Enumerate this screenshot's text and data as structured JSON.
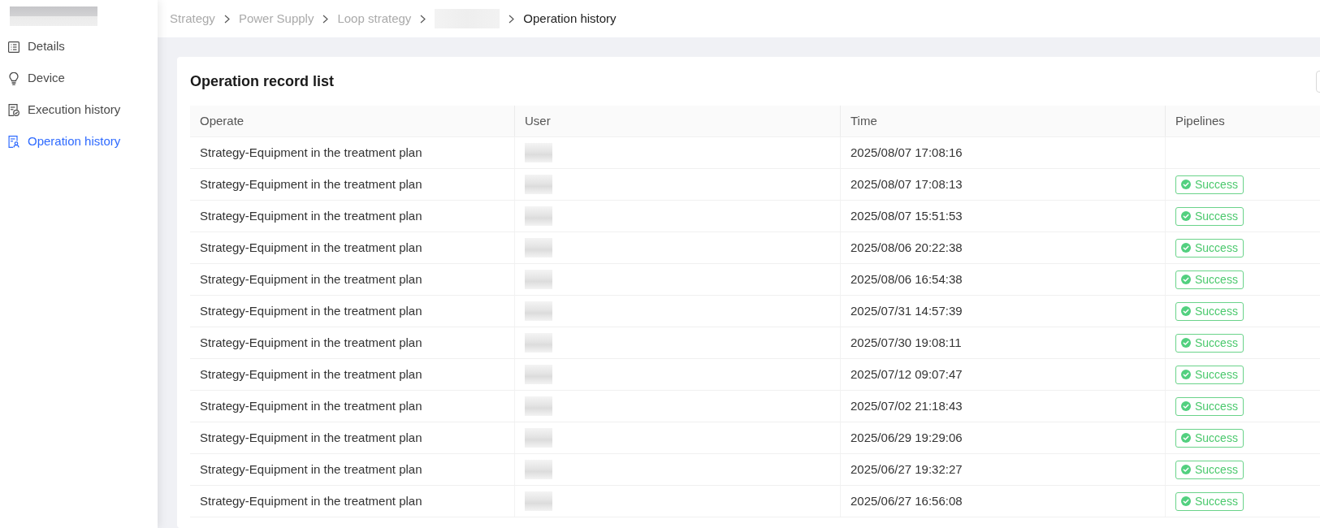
{
  "sidebar": {
    "items": [
      {
        "label": "Details",
        "selected": false
      },
      {
        "label": "Device",
        "selected": false
      },
      {
        "label": "Execution history",
        "selected": false
      },
      {
        "label": "Operation history",
        "selected": true
      }
    ]
  },
  "breadcrumb": [
    {
      "kind": "link",
      "label": "Strategy"
    },
    {
      "kind": "link",
      "label": "Power Supply"
    },
    {
      "kind": "link",
      "label": "Loop strategy"
    },
    {
      "kind": "redacted"
    },
    {
      "kind": "current",
      "label": "Operation history"
    }
  ],
  "card": {
    "title": "Operation record list"
  },
  "table": {
    "columns": [
      "Operate",
      "User",
      "Time",
      "Pipelines"
    ],
    "rows": [
      {
        "operate": "Strategy-Equipment in the treatment plan",
        "time": "2025/08/07 17:08:16"
      },
      {
        "operate": "Strategy-Equipment in the treatment plan",
        "time": "2025/08/07 17:08:13",
        "pipeline": "Success"
      },
      {
        "operate": "Strategy-Equipment in the treatment plan",
        "time": "2025/08/07 15:51:53",
        "pipeline": "Success"
      },
      {
        "operate": "Strategy-Equipment in the treatment plan",
        "time": "2025/08/06 20:22:38",
        "pipeline": "Success"
      },
      {
        "operate": "Strategy-Equipment in the treatment plan",
        "time": "2025/08/06 16:54:38",
        "pipeline": "Success"
      },
      {
        "operate": "Strategy-Equipment in the treatment plan",
        "time": "2025/07/31 14:57:39",
        "pipeline": "Success"
      },
      {
        "operate": "Strategy-Equipment in the treatment plan",
        "time": "2025/07/30 19:08:11",
        "pipeline": "Success"
      },
      {
        "operate": "Strategy-Equipment in the treatment plan",
        "time": "2025/07/12 09:07:47",
        "pipeline": "Success"
      },
      {
        "operate": "Strategy-Equipment in the treatment plan",
        "time": "2025/07/02 21:18:43",
        "pipeline": "Success"
      },
      {
        "operate": "Strategy-Equipment in the treatment plan",
        "time": "2025/06/29 19:29:06",
        "pipeline": "Success"
      },
      {
        "operate": "Strategy-Equipment in the treatment plan",
        "time": "2025/06/27 19:32:27",
        "pipeline": "Success"
      },
      {
        "operate": "Strategy-Equipment in the treatment plan",
        "time": "2025/06/27 16:56:08",
        "pipeline": "Success"
      }
    ]
  }
}
